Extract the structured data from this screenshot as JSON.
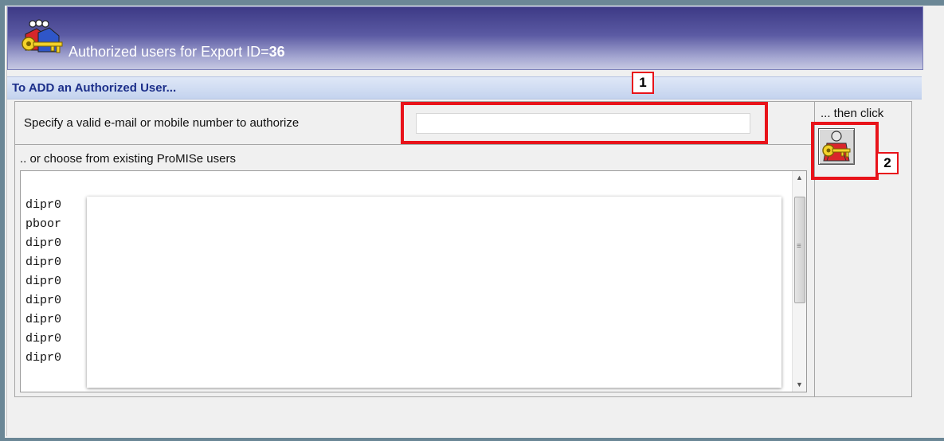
{
  "window": {
    "title_prefix": "Authorized users for Export ID=",
    "export_id": "36"
  },
  "add_section": {
    "header": "To ADD an Authorized User...",
    "specify_label": "Specify a valid e-mail or mobile number to authorize",
    "input_value": "",
    "then_click_label": "... then click",
    "choose_label": ".. or choose from existing ProMISe users"
  },
  "users": [
    "dipr0",
    "pboor",
    "dipr0",
    "dipr0",
    "dipr0",
    "dipr0",
    "dipr0",
    "dipr0",
    "dipr0"
  ],
  "callouts": {
    "one": "1",
    "two": "2"
  },
  "icons": {
    "title_icon": "users-key-icon",
    "authorize_button_icon": "user-key-icon"
  },
  "colors": {
    "callout_red": "#e8131a",
    "section_header_text": "#1c2f8a"
  }
}
